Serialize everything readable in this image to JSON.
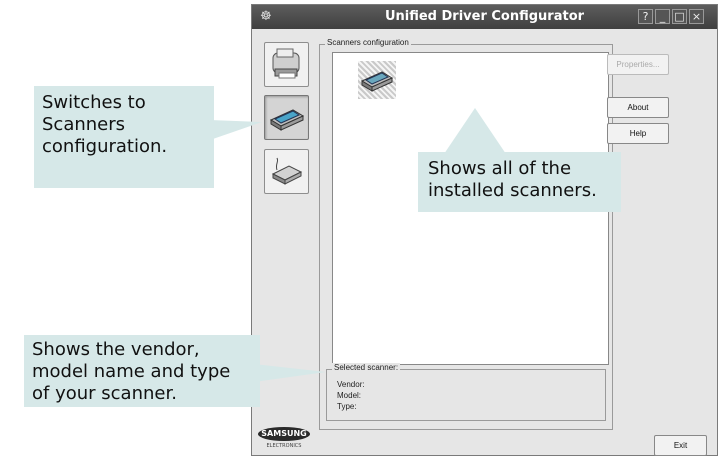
{
  "window": {
    "title": "Unified Driver Configurator",
    "controls": [
      "?",
      "_",
      "□",
      "×"
    ]
  },
  "sidebar": {
    "items": [
      {
        "name": "printers",
        "icon": "printer-icon"
      },
      {
        "name": "scanners",
        "icon": "scanner-icon",
        "active": true
      },
      {
        "name": "ports",
        "icon": "port-icon"
      }
    ]
  },
  "scanners_group": {
    "title": "Scanners configuration"
  },
  "buttons": {
    "properties": "Properties...",
    "about": "About",
    "help": "Help",
    "exit": "Exit"
  },
  "selected_scanner": {
    "title": "Selected scanner:",
    "vendor_label": "Vendor:",
    "model_label": "Model:",
    "type_label": "Type:"
  },
  "callouts": {
    "sidebar": [
      "Switches to",
      "Scanners",
      "configuration."
    ],
    "list": [
      "Shows all of the",
      "installed scanners."
    ],
    "info": [
      "Shows the vendor,",
      "model name and type",
      "of your scanner."
    ]
  },
  "logo": {
    "brand": "SAMSUNG",
    "sub": "ELECTRONICS"
  },
  "colors": {
    "callout_bg": "#d6e8e8",
    "titlebar": "#4a4a4a",
    "window_bg": "#e6e6e6"
  }
}
